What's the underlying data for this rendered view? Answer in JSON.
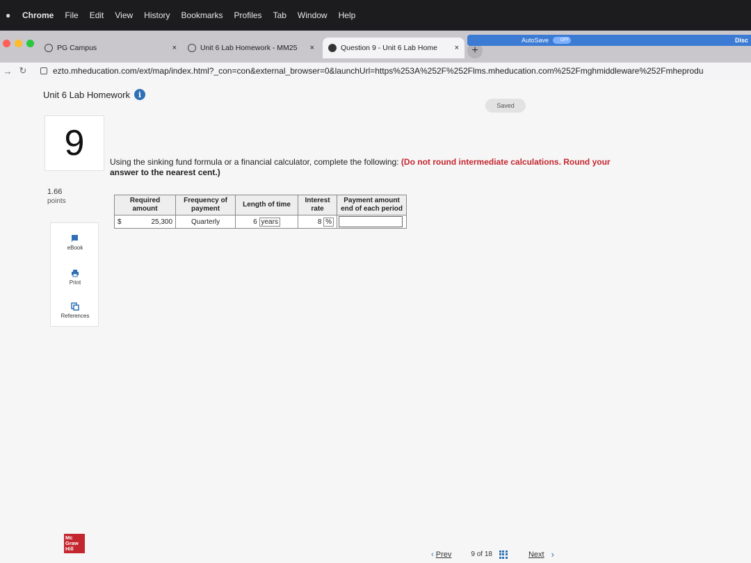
{
  "menubar": {
    "app": "Chrome",
    "items": [
      "File",
      "Edit",
      "View",
      "History",
      "Bookmarks",
      "Profiles",
      "Tab",
      "Window",
      "Help"
    ]
  },
  "tabs": [
    {
      "label": "PG Campus",
      "close": "×"
    },
    {
      "label": "Unit 6 Lab Homework - MM25",
      "close": "×"
    },
    {
      "label": "Question 9 - Unit 6 Lab Home",
      "close": "×"
    }
  ],
  "new_tab": "+",
  "autosave": {
    "label": "AutoSave",
    "state": "OFF",
    "extra": "Disc"
  },
  "address": {
    "url": "ezto.mheducation.com/ext/map/index.html?_con=con&external_browser=0&launchUrl=https%253A%252F%252Flms.mheducation.com%252Fmghmiddleware%252Fmheprodu"
  },
  "assignment": {
    "title": "Unit 6 Lab Homework",
    "info": "i",
    "status": "Saved"
  },
  "question": {
    "number": "9",
    "points": "1.66",
    "points_label": "points",
    "prompt_plain": "Using the sinking fund formula or a financial calculator, complete the following: ",
    "prompt_red": "(Do not round intermediate calculations. Round your",
    "prompt_tail": "answer to the nearest cent.)"
  },
  "tools": [
    {
      "label": "eBook",
      "icon": "ebook-icon"
    },
    {
      "label": "Print",
      "icon": "print-icon"
    },
    {
      "label": "References",
      "icon": "references-icon"
    }
  ],
  "table": {
    "headers": [
      "Required amount",
      "Frequency of payment",
      "Length of time",
      "Interest rate",
      "Payment amount end of each period"
    ],
    "row": {
      "currency": "$",
      "amount": "25,300",
      "frequency": "Quarterly",
      "length_value": "6",
      "length_unit": "years",
      "rate_value": "8",
      "rate_unit": "%",
      "payment": ""
    }
  },
  "footer": {
    "prev": "Prev",
    "page_current": "9",
    "page_of": "of",
    "page_total": "18",
    "next": "Next"
  },
  "logo": {
    "line1": "Mc",
    "line2": "Graw",
    "line3": "Hill"
  }
}
